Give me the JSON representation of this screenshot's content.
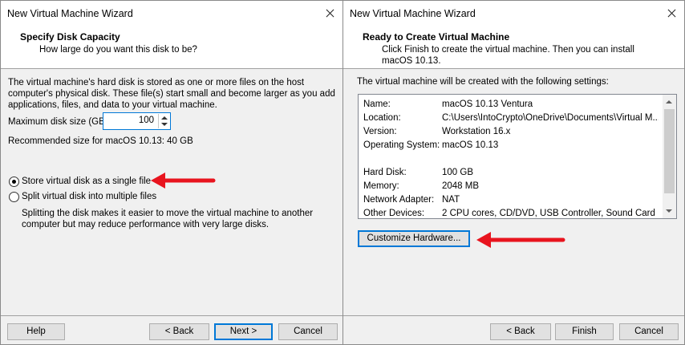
{
  "left": {
    "window_title": "New Virtual Machine Wizard",
    "header_title": "Specify Disk Capacity",
    "header_subtitle": "How large do you want this disk to be?",
    "description": "The virtual machine's hard disk is stored as one or more files on the host computer's physical disk. These file(s) start small and become larger as you add applications, files, and data to your virtual machine.",
    "max_disk_label": "Maximum disk size (GB):",
    "max_disk_value": "100",
    "recommended": "Recommended size for macOS 10.13: 40 GB",
    "radio_single": "Store virtual disk as a single file",
    "radio_split": "Split virtual disk into multiple files",
    "split_note": "Splitting the disk makes it easier to move the virtual machine to another computer but may reduce performance with very large disks.",
    "buttons": {
      "help": "Help",
      "back": "< Back",
      "next": "Next >",
      "cancel": "Cancel"
    }
  },
  "right": {
    "window_title": "New Virtual Machine Wizard",
    "header_title": "Ready to Create Virtual Machine",
    "header_subtitle": "Click Finish to create the virtual machine. Then you can install macOS 10.13.",
    "intro": "The virtual machine will be created with the following settings:",
    "settings": [
      {
        "label": "Name:",
        "value": "macOS 10.13 Ventura"
      },
      {
        "label": "Location:",
        "value": "C:\\Users\\IntoCrypto\\OneDrive\\Documents\\Virtual M..."
      },
      {
        "label": "Version:",
        "value": "Workstation 16.x"
      },
      {
        "label": "Operating System:",
        "value": "macOS 10.13"
      },
      {
        "label": "Hard Disk:",
        "value": "100 GB"
      },
      {
        "label": "Memory:",
        "value": "2048 MB"
      },
      {
        "label": "Network Adapter:",
        "value": "NAT"
      },
      {
        "label": "Other Devices:",
        "value": "2 CPU cores, CD/DVD, USB Controller, Sound Card"
      }
    ],
    "customize_button": "Customize Hardware...",
    "buttons": {
      "back": "< Back",
      "finish": "Finish",
      "cancel": "Cancel"
    }
  },
  "colors": {
    "annotation_arrow": "#e8141e",
    "accent": "#0078d7"
  }
}
